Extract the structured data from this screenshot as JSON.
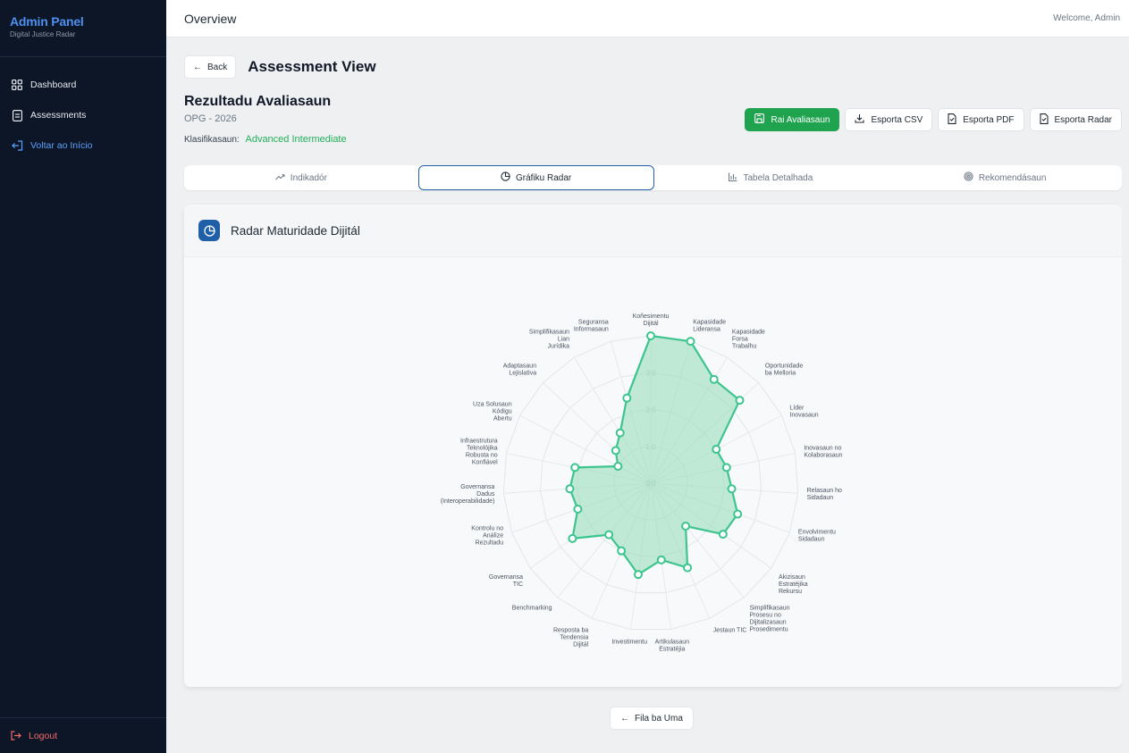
{
  "sidebar": {
    "brand_title": "Admin Panel",
    "brand_sub": "Digital Justice Radar",
    "items": [
      {
        "label": "Dashboard",
        "icon": "grid-icon"
      },
      {
        "label": "Assessments",
        "icon": "document-icon"
      },
      {
        "label": "Voltar ao Início",
        "icon": "back-door-icon"
      }
    ],
    "logout": "Logout"
  },
  "topbar": {
    "title": "Overview",
    "welcome": "Welcome, Admin"
  },
  "main": {
    "back_label": "Back",
    "page_title": "Assessment View",
    "result_title": "Rezultadu Avaliasaun",
    "result_sub": "OPG - 2026",
    "klas_label": "Klasifikasaun:",
    "klas_value": "Advanced Intermediate",
    "actions": {
      "save": "Rai Avaliasaun",
      "csv": "Esporta CSV",
      "pdf": "Esporta PDF",
      "radar": "Esporta Radar"
    },
    "tabs": [
      "Indikadór",
      "Gráfiku Radar",
      "Tabela Detalhada",
      "Rekomendásaun"
    ],
    "card_title": "Radar Maturidade Dijitál",
    "bottom_button": "Fila ba Uma"
  },
  "colors": {
    "accent_green": "#1fa34f",
    "radar_stroke": "#3cc58e",
    "radar_fill": "#8fdcb4",
    "active_tab_border": "#1f5fa8"
  },
  "chart_data": {
    "type": "radar",
    "rlim": [
      0,
      4
    ],
    "ticks": [
      "0.0",
      "1.0",
      "2.0",
      "3.0"
    ],
    "categories": [
      "Koñesimentu Dijitál",
      "Kapasidade Lideransa",
      "Kapasidade Forsa Trabalhu",
      "Oportunidade ba Melloria",
      "Líder Inovasaun",
      "Inovasaun no Kolaborasaun",
      "Relasaun ho Sidadaun",
      "Envolvimentu Sidadaun",
      "Akizisaun Estratéjika Rekursu",
      "Simplifikasaun Prosesu no Dijitalizasaun Prosedimentu",
      "Jestaun TIC",
      "Artikulasaun Estratéjia",
      "Investimentu",
      "Resposta ba Tendensia Dijitál",
      "Benchmarking",
      "Governansa TIC",
      "Kontrolu no Análize Rezultadu",
      "Governansa Dadus (Interoperabilidade)",
      "Infraestrutura Teknolójika Robusta no Konfiável",
      "Uza Solusaun Kódigu Abertu",
      "Adaptasaun Lejislativa",
      "Simplifikasaun Lian Jurídika",
      "Seguransa Informasaun"
    ],
    "values": [
      4.0,
      4.0,
      3.3,
      3.3,
      2.0,
      2.1,
      2.2,
      2.5,
      2.4,
      1.5,
      2.5,
      2.1,
      2.5,
      2.0,
      1.8,
      2.6,
      2.1,
      2.2,
      2.1,
      1.0,
      1.3,
      1.6,
      2.4
    ],
    "label_lines": [
      [
        "Koñesimentu",
        "Dijitál"
      ],
      [
        "Kapasidade",
        "Lideransa"
      ],
      [
        "Kapasidade",
        "Forsa",
        "Trabalhu"
      ],
      [
        "Oportunidade",
        "ba Melloria"
      ],
      [
        "Líder",
        "Inovasaun"
      ],
      [
        "Inovasaun no",
        "Kolaborasaun"
      ],
      [
        "Relasaun ho",
        "Sidadaun"
      ],
      [
        "Envolvimentu",
        "Sidadaun"
      ],
      [
        "Akizisaun",
        "Estratéjika",
        "Rekursu"
      ],
      [
        "Simplifikasaun",
        "Prosesu no",
        "Dijitalizasaun",
        "Prosedimentu"
      ],
      [
        "Jestaun TIC"
      ],
      [
        "Artikulasaun",
        "Estratéjia"
      ],
      [
        "Investimentu"
      ],
      [
        "Resposta ba",
        "Tendensia",
        "Dijitál"
      ],
      [
        "Benchmarking"
      ],
      [
        "Governansa",
        "TIC"
      ],
      [
        "Kontrolu no",
        "Análize",
        "Rezultadu"
      ],
      [
        "Governansa",
        "Dadus",
        "(Interoperabilidade)"
      ],
      [
        "Infraestrutura",
        "Teknolójika",
        "Robusta no",
        "Konfiável"
      ],
      [
        "Uza Solusaun",
        "Kódigu",
        "Abertu"
      ],
      [
        "Adaptasaun",
        "Lejislativa"
      ],
      [
        "Simplifikasaun",
        "Lian",
        "Jurídika"
      ],
      [
        "Seguransa",
        "Informasaun"
      ]
    ]
  }
}
